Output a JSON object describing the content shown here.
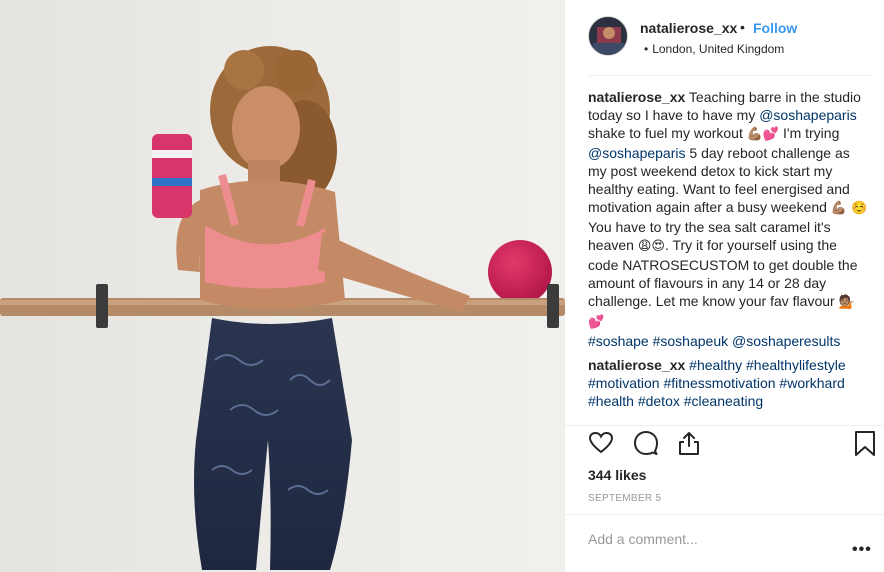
{
  "post": {
    "username": "natalierose_xx",
    "separator": "•",
    "follow_label": "Follow",
    "location_bullet": "•",
    "location": "London, United Kingdom"
  },
  "caption": {
    "user": "natalierose_xx",
    "t1": " Teaching barre in the studio today so I have to have my ",
    "m1": "@soshapeparis",
    "t2": " shake to fuel my workout ",
    "e1": "💪🏽💕",
    "t3": " I'm trying ",
    "m2": "@soshapeparis",
    "t4": " 5 day reboot challenge as my post weekend detox to kick start my healthy eating. Want to feel energised and motivation again after a busy weekend ",
    "e2": "💪🏽 ☺️",
    "t5": " You have to try the sea salt caramel it's heaven ",
    "e3": "😩😍",
    "t6": ". Try it for yourself using the code NATROSECUSTOM to get double the amount of flavours in any 14 or 28 day challenge. Let me know your fav flavour ",
    "e4": "💁🏽💕",
    "tags": "#soshape #soshapeuk @soshaperesults"
  },
  "comment2": {
    "user": "natalierose_xx",
    "tags": " #healthy #healthylifestyle #motivation #fitnessmotivation #workhard #health #detox #cleaneating"
  },
  "icons": {
    "like": "heart-icon",
    "comment": "comment-bubble-icon",
    "share": "share-icon",
    "save": "bookmark-icon",
    "more": "more-options-icon"
  },
  "likes": "344 likes",
  "date": "SEPTEMBER 5",
  "comment_box": {
    "placeholder": "Add a comment..."
  },
  "more_label": "•••",
  "colors": {
    "link_blue": "#3897f0",
    "tag_blue": "#003569",
    "text": "#262626",
    "muted": "#999999"
  }
}
